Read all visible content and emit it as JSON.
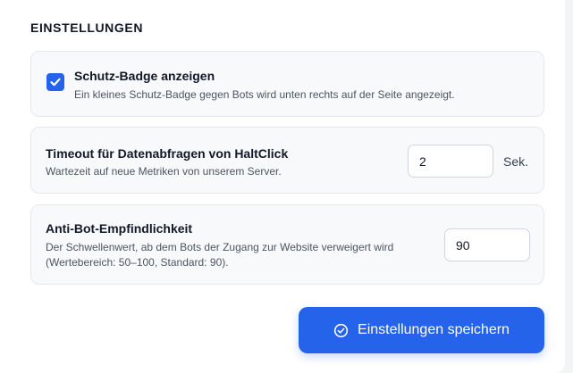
{
  "section": {
    "heading": "EINSTELLUNGEN"
  },
  "badge_setting": {
    "checked": true,
    "title": "Schutz-Badge anzeigen",
    "description": "Ein kleines Schutz-Badge gegen Bots wird unten rechts auf der Seite angezeigt."
  },
  "timeout_setting": {
    "title": "Timeout für Datenabfragen von HaltClick",
    "description": "Wartezeit auf neue Metriken von unserem Server.",
    "value": "2",
    "unit": "Sek."
  },
  "sensitivity_setting": {
    "title": "Anti-Bot-Empfindlichkeit",
    "description": "Der Schwellenwert, ab dem Bots der Zugang zur Website verweigert wird (Wertebereich: 50–100, Standard: 90).",
    "value": "90"
  },
  "save_button": {
    "label": "Einstellungen speichern",
    "icon": "check-circle-icon"
  },
  "colors": {
    "accent": "#2563eb",
    "card_background": "#f8f9fb",
    "card_border": "#e5e7eb"
  }
}
